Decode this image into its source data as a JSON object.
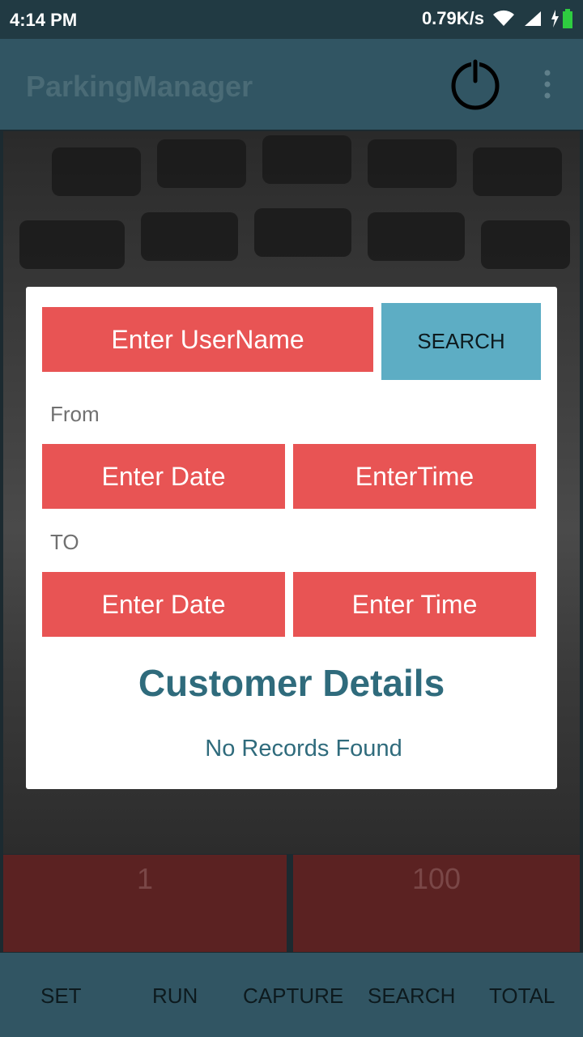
{
  "status_bar": {
    "time": "4:14 PM",
    "speed": "0.79K/s"
  },
  "app_bar": {
    "title": "ParkingManager"
  },
  "stats": {
    "left_value": "1",
    "right_value": "100"
  },
  "dialog": {
    "username_placeholder": "Enter UserName",
    "search_label": "SEARCH",
    "from_label": "From",
    "to_label": "TO",
    "from_date": "Enter Date",
    "from_time": "EnterTime",
    "to_date": "Enter Date",
    "to_time": "Enter Time",
    "details_title": "Customer Details",
    "no_records": "No Records Found"
  },
  "bottom_nav": {
    "items": [
      "SET",
      "RUN",
      "CAPTURE",
      "SEARCH",
      "TOTAL"
    ]
  },
  "colors": {
    "app_bar": "#315563",
    "field_red": "#e85454",
    "search_blue": "#5dadc4",
    "title_teal": "#2f6b7c"
  }
}
